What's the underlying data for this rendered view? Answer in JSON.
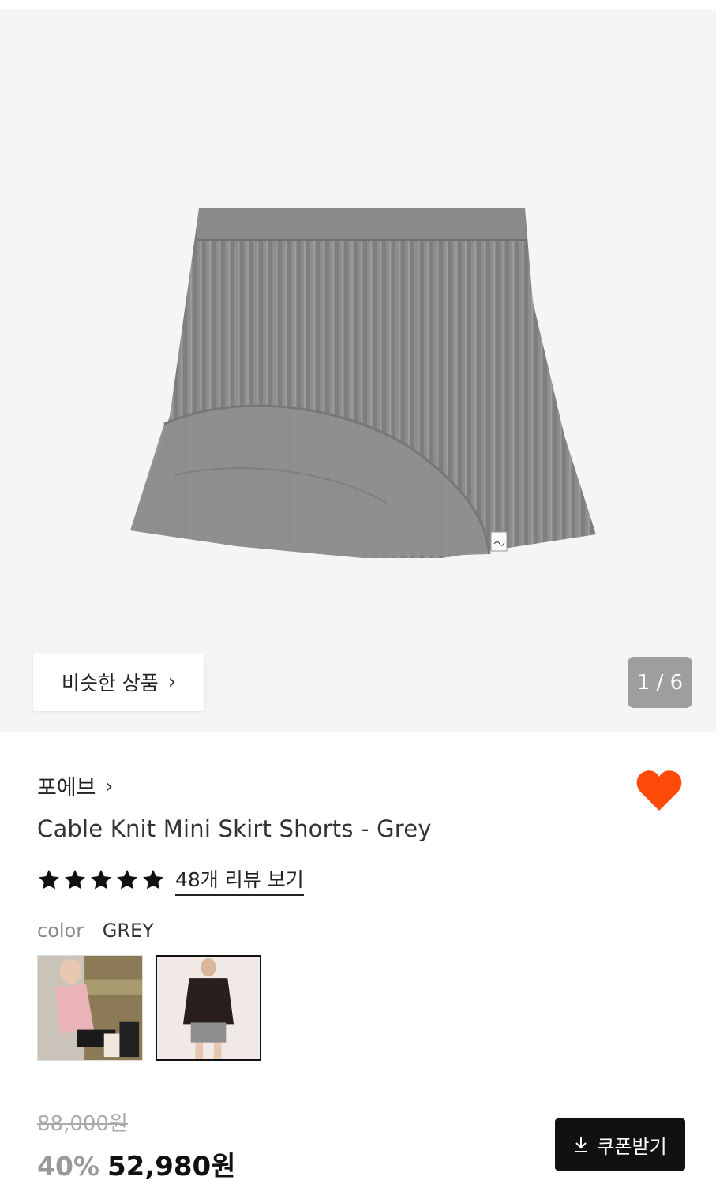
{
  "gallery": {
    "similar_label": "비슷한 상품",
    "page_indicator": "1 / 6"
  },
  "product": {
    "brand": "포에브",
    "title": "Cable Knit Mini Skirt Shorts - Grey",
    "rating_stars": 5,
    "review_link": "48개 리뷰 보기",
    "color_label": "color",
    "color_value": "GREY",
    "favorited": true
  },
  "pricing": {
    "original": "88,000원",
    "discount": "40%",
    "sale": "52,980원",
    "coupon_label": "쿠폰받기"
  },
  "colors": {
    "heart": "#ff4a0a",
    "indicator_bg": "#9e9e9e",
    "coupon_bg": "#111111"
  },
  "icons": {
    "similar_chevron": "chevron-right-icon",
    "brand_chevron": "chevron-right-icon",
    "favorite": "heart-icon",
    "rating": "star-icon",
    "coupon": "download-icon"
  }
}
